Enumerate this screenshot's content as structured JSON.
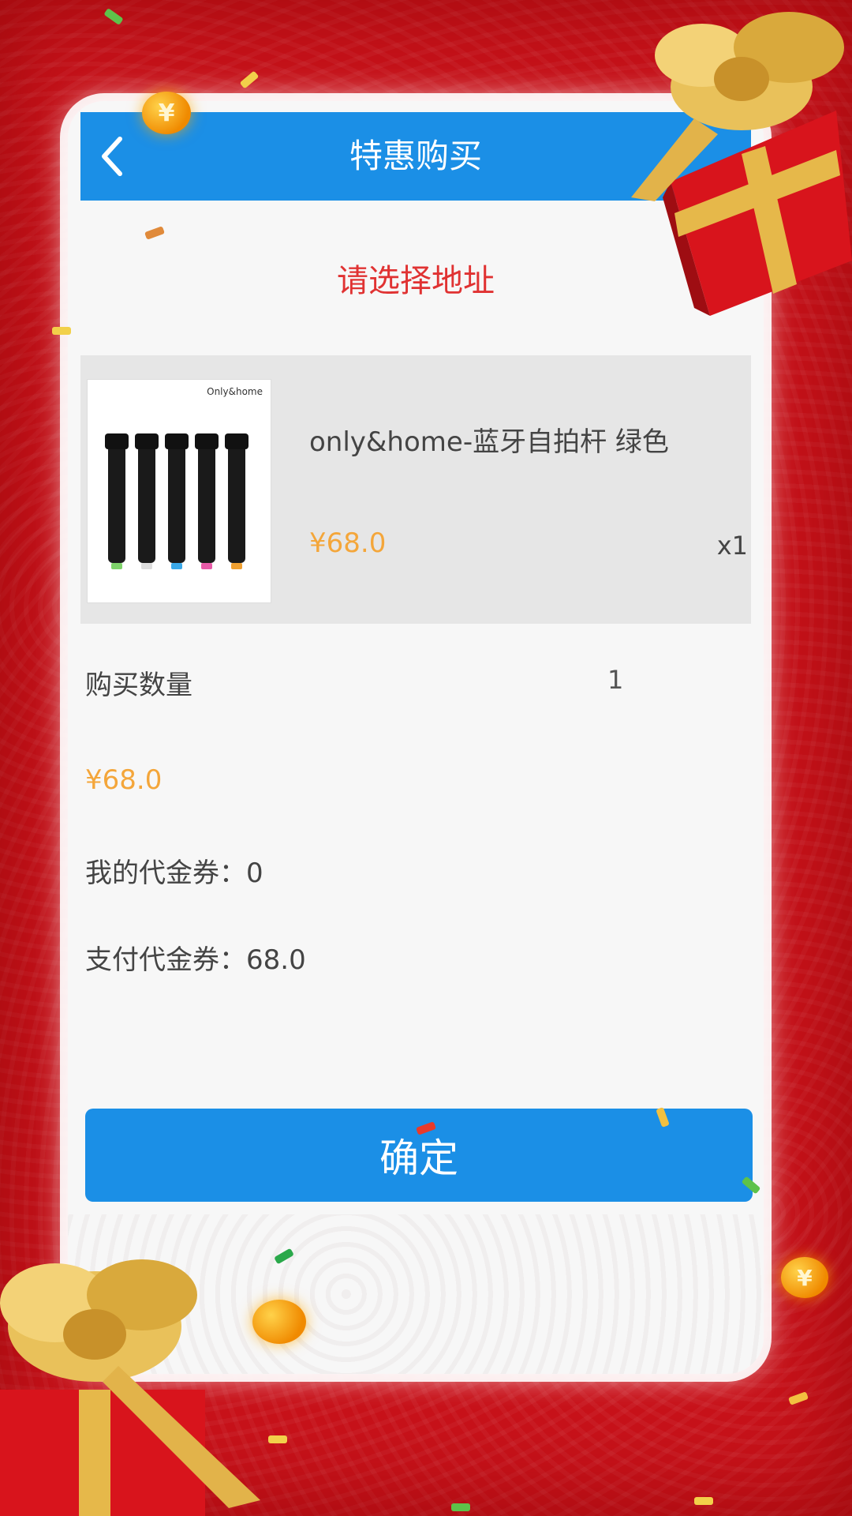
{
  "header": {
    "title": "特惠购买",
    "back_icon": "chevron-left-icon"
  },
  "address": {
    "prompt": "请选择地址"
  },
  "product": {
    "name": "only&home-蓝牙自拍杆 绿色",
    "price": "¥68.0",
    "quantity": "x1",
    "image_brand": "Only&home"
  },
  "purchase": {
    "quantity_label": "购买数量",
    "quantity_value": "1",
    "total_price": "¥68.0",
    "my_vouchers": "我的代金券：0",
    "pay_vouchers": "支付代金券：68.0"
  },
  "actions": {
    "confirm_label": "确定"
  },
  "decor": {
    "coin_symbol": "¥"
  },
  "colors": {
    "accent": "#1b8fe6",
    "price": "#f4a63a",
    "address": "#e03232",
    "background": "#c8121a"
  }
}
